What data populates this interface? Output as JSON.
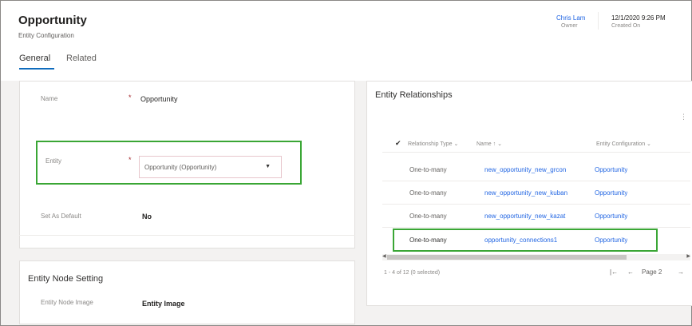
{
  "header": {
    "title": "Opportunity",
    "subtitle": "Entity Configuration",
    "owner": {
      "value": "Chris Lam",
      "label": "Owner"
    },
    "created_on": {
      "value": "12/1/2020 9:26 PM",
      "label": "Created On"
    }
  },
  "tabs": [
    {
      "label": "General",
      "selected": true
    },
    {
      "label": "Related",
      "selected": false
    }
  ],
  "general": {
    "name": {
      "label": "Name",
      "value": "Opportunity",
      "required": "*"
    },
    "entity": {
      "label": "Entity",
      "value": "Opportunity (Opportunity)",
      "required": "*"
    },
    "set_as_default": {
      "label": "Set As Default",
      "value": "No"
    }
  },
  "node_setting": {
    "title": "Entity Node Setting",
    "image": {
      "label": "Entity Node Image",
      "value": "Entity Image"
    }
  },
  "relationships": {
    "title": "Entity Relationships",
    "columns": [
      "Relationship Type",
      "Name",
      "Entity Configuration"
    ],
    "sort_indicator": "↑",
    "rows": [
      {
        "type": "One-to-many",
        "name": "new_opportunity_new_grcon",
        "config": "Opportunity"
      },
      {
        "type": "One-to-many",
        "name": "new_opportunity_new_kuban",
        "config": "Opportunity"
      },
      {
        "type": "One-to-many",
        "name": "new_opportunity_new_kazat",
        "config": "Opportunity"
      },
      {
        "type": "One-to-many",
        "name": "opportunity_connections1",
        "config": "Opportunity"
      }
    ],
    "footer": "1 - 4 of 12 (0 selected)",
    "page_label": "Page 2"
  },
  "colors": {
    "highlight": "#3aa635",
    "link": "#2266e3",
    "tab_underline": "#0f6cbd"
  }
}
